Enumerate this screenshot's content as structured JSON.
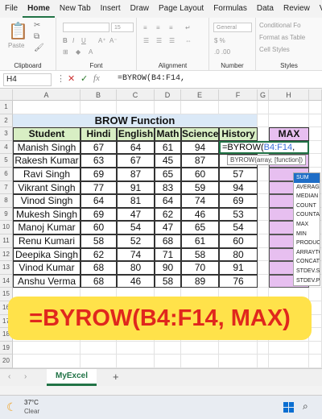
{
  "menu": {
    "tabs": [
      "File",
      "Home",
      "New Tab",
      "Insert",
      "Draw",
      "Page Layout",
      "Formulas",
      "Data",
      "Review",
      "View"
    ],
    "active": "Home"
  },
  "ribbon": {
    "groups": [
      "Clipboard",
      "Font",
      "Alignment",
      "Number",
      "Styles"
    ],
    "paste_label": "Paste",
    "font_size": "15",
    "number_format": "General",
    "styles_items": [
      "Conditional Fo",
      "Format as Table",
      "Cell Styles"
    ],
    "history_label": "History"
  },
  "formula_bar": {
    "name_box": "H4",
    "fx": "fx",
    "formula": "=BYROW(B4:F14,"
  },
  "grid": {
    "columns": [
      "A",
      "B",
      "C",
      "D",
      "E",
      "F",
      "G",
      "H"
    ],
    "rows": [
      "1",
      "2",
      "3",
      "4",
      "5",
      "6",
      "7",
      "8",
      "9",
      "10",
      "11",
      "12",
      "13",
      "14",
      "15",
      "16",
      "17",
      "18",
      "19",
      "20"
    ],
    "title": "BROW Function",
    "headers": [
      "Student",
      "Hindi",
      "English",
      "Math",
      "Science",
      "History"
    ],
    "max_header": "MAX",
    "students": [
      {
        "name": "Manish Singh",
        "scores": [
          "67",
          "64",
          "61",
          "94",
          ""
        ]
      },
      {
        "name": "Rakesh Kumar",
        "scores": [
          "63",
          "67",
          "45",
          "87",
          "57"
        ]
      },
      {
        "name": "Ravi Singh",
        "scores": [
          "69",
          "87",
          "65",
          "60",
          "57"
        ]
      },
      {
        "name": "Vikrant Singh",
        "scores": [
          "77",
          "91",
          "83",
          "59",
          "94"
        ]
      },
      {
        "name": "Vinod Singh",
        "scores": [
          "64",
          "81",
          "64",
          "74",
          "69"
        ]
      },
      {
        "name": "Mukesh Singh",
        "scores": [
          "69",
          "47",
          "62",
          "46",
          "53"
        ]
      },
      {
        "name": "Manoj Kumar",
        "scores": [
          "60",
          "54",
          "47",
          "65",
          "54"
        ]
      },
      {
        "name": "Renu Kumari",
        "scores": [
          "58",
          "52",
          "68",
          "61",
          "60"
        ]
      },
      {
        "name": "Deepika Singh",
        "scores": [
          "62",
          "74",
          "71",
          "58",
          "80"
        ]
      },
      {
        "name": "Vinod Kumar",
        "scores": [
          "68",
          "80",
          "90",
          "70",
          "91"
        ]
      },
      {
        "name": "Anshu Verma",
        "scores": [
          "68",
          "46",
          "58",
          "89",
          "76"
        ]
      }
    ],
    "edit_prefix": "=BYROW(",
    "edit_ref": "B4:F14",
    "edit_suffix": ",",
    "tooltip": "BYROW(array, [function])",
    "autocomplete": [
      "SUM",
      "AVERAGE",
      "MEDIAN",
      "COUNT",
      "COUNTA",
      "MAX",
      "MIN",
      "PRODUCT",
      "ARRAYTO",
      "CONCAT",
      "STDEV.S",
      "STDEV.P"
    ]
  },
  "banner": "=BYROW(B4:F14, MAX)",
  "sheet_tab": "MyExcel",
  "taskbar": {
    "temperature": "37°C",
    "weather": "Clear"
  },
  "colors": {
    "title_bg": "#dbe9f7",
    "header_bg": "#d8eec4",
    "max_bg": "#e7bff0",
    "banner_bg": "#ffe24a",
    "banner_text": "#e0271d",
    "excel_green": "#217346"
  }
}
